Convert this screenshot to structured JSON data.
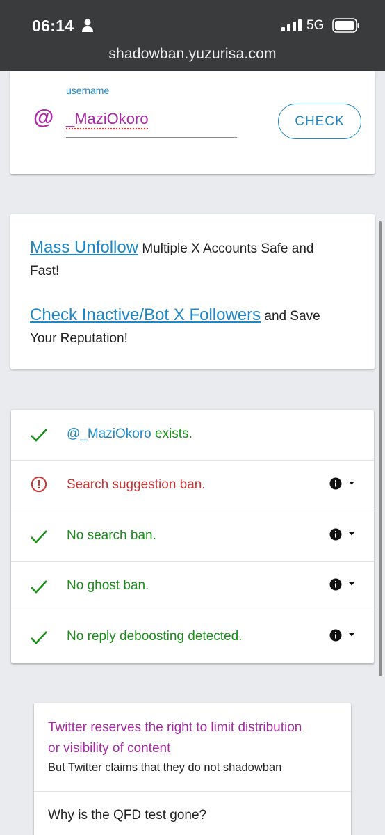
{
  "status_bar": {
    "time": "06:14",
    "network": "5G",
    "url": "shadowban.yuzurisa.com"
  },
  "search": {
    "at_symbol": "@",
    "field_label": "username",
    "username": "_MaziOkoro",
    "check_label": "CHECK"
  },
  "promo": {
    "line1_link": "Mass Unfollow",
    "line1_rest_a": " Multiple X Accounts Safe and",
    "line1_rest_b": "Fast!",
    "line2_link": "Check Inactive/Bot X Followers",
    "line2_rest_a": " and Save",
    "line2_rest_b": "Your Reputation!"
  },
  "results": [
    {
      "status": "ok",
      "mention": "@_MaziOkoro",
      "text": " exists."
    },
    {
      "status": "warning",
      "text": "Search suggestion ban."
    },
    {
      "status": "ok",
      "text": "No search ban."
    },
    {
      "status": "ok",
      "text": "No ghost ban."
    },
    {
      "status": "ok",
      "text": "No reply deboosting detected."
    }
  ],
  "note": {
    "line1": "Twitter reserves the right to limit distribution",
    "line2": "or visibility of content",
    "strikethrough": "But Twitter claims that they do not shadowban",
    "faq_question": "Why is the QFD test gone?"
  },
  "colors": {
    "ok": "#1a8f1a",
    "warning": "#c93535",
    "accent": "#1e88c7",
    "username": "#a62aa2"
  }
}
